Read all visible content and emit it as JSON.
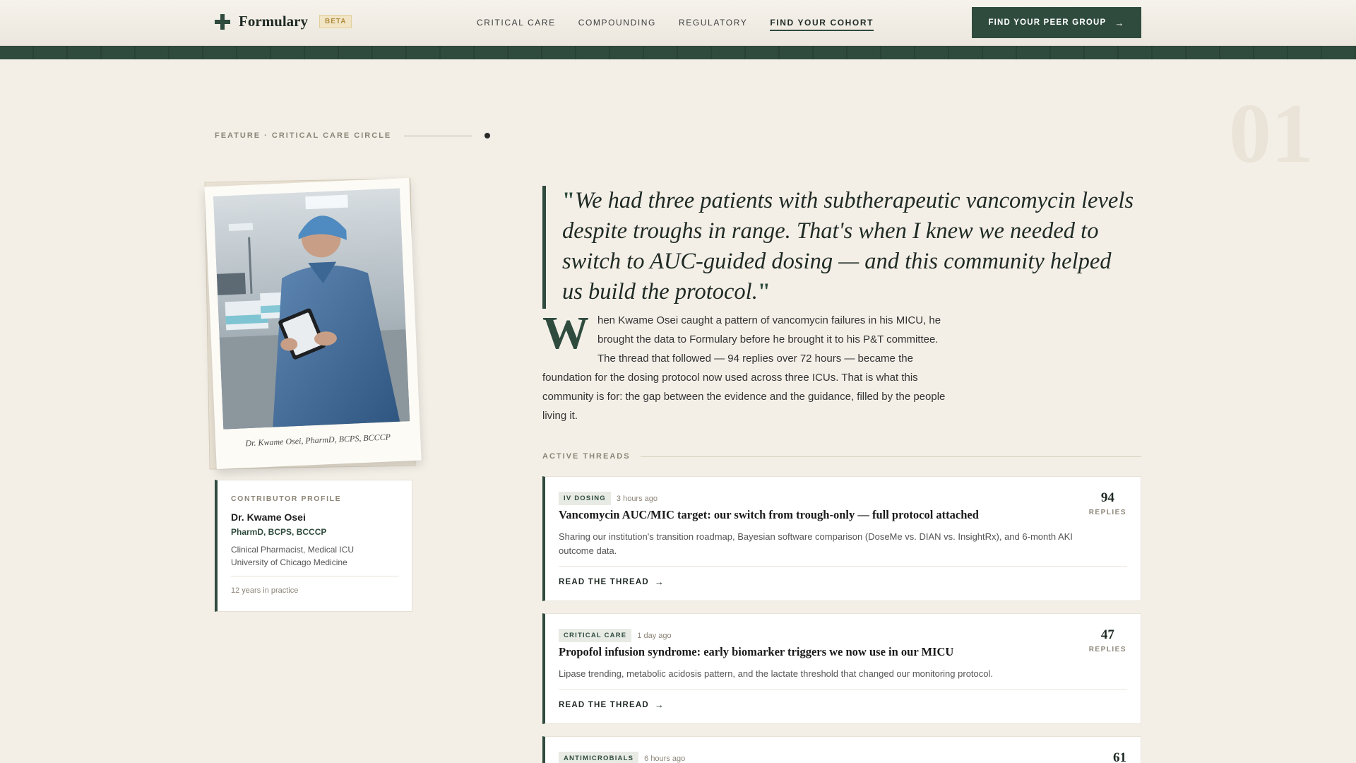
{
  "header": {
    "logo_text": "Formulary",
    "beta_label": "BETA",
    "nav": [
      {
        "label": "CRITICAL CARE"
      },
      {
        "label": "COMPOUNDING"
      },
      {
        "label": "REGULATORY"
      },
      {
        "label": "FIND YOUR COHORT",
        "active": true
      }
    ],
    "cta_label": "FIND YOUR PEER GROUP"
  },
  "feature": {
    "number": "01",
    "eyebrow": "FEATURE · CRITICAL CARE CIRCLE"
  },
  "polaroid": {
    "caption": "Dr. Kwame Osei, PharmD, BCPS, BCCCP"
  },
  "contributor": {
    "label": "CONTRIBUTOR PROFILE",
    "name": "Dr. Kwame Osei",
    "credentials": "PharmD, BCPS, BCCCP",
    "role": "Clinical Pharmacist, Medical ICU",
    "institution": "University of Chicago Medicine",
    "years": "12 years in practice"
  },
  "quote": {
    "open_mark": "\"",
    "text": "We had three patients with subtherapeutic vancomycin levels despite troughs in range. That's when I knew we needed to switch to AUC-guided dosing — and this community helped us build the protocol.",
    "close_mark": "\""
  },
  "lede": {
    "dropcap": "W",
    "text": "hen Kwame Osei caught a pattern of vancomycin failures in his MICU, he brought the data to Formulary before he brought it to his P&T committee. The thread that followed — 94 replies over 72 hours — became the foundation for the dosing protocol now used across three ICUs. That is what this community is for: the gap between the evidence and the guidance, filled by the people living it."
  },
  "threads": {
    "label": "ACTIVE THREADS",
    "items": [
      {
        "tag": "IV DOSING",
        "time": "3 hours ago",
        "title": "Vancomycin AUC/MIC target: our switch from trough-only — full protocol attached",
        "desc": "Sharing our institution's transition roadmap, Bayesian software comparison (DoseMe vs. DIAN vs. InsightRx), and 6-month AKI outcome data.",
        "read": "READ THE THREAD",
        "count": "94",
        "count_label": "REPLIES"
      },
      {
        "tag": "CRITICAL CARE",
        "time": "1 day ago",
        "title": "Propofol infusion syndrome: early biomarker triggers we now use in our MICU",
        "desc": "Lipase trending, metabolic acidosis pattern, and the lactate threshold that changed our monitoring protocol.",
        "read": "READ THE THREAD",
        "count": "47",
        "count_label": "REPLIES"
      },
      {
        "tag": "ANTIMICROBIALS",
        "time": "6 hours ago",
        "count": "61"
      }
    ]
  },
  "colors": {
    "accent": "#2f4b3e",
    "background": "#f3efe7",
    "beta": "#b08a3e"
  },
  "icons": {
    "logo": "medical-cross-icon",
    "cta": "arrow-right-icon",
    "read": "arrow-right-icon"
  }
}
